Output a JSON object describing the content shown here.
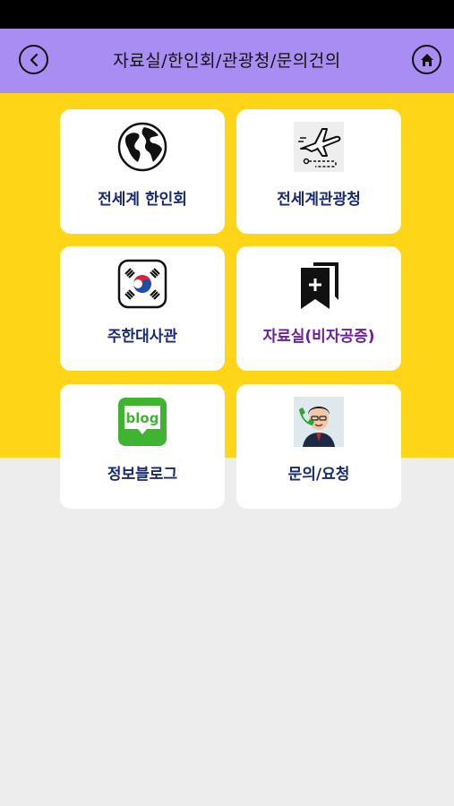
{
  "header": {
    "title": "자료실/한인회/관광청/문의건의",
    "back_icon": "chevron-left-icon",
    "home_icon": "home-icon"
  },
  "menu": [
    {
      "label": "전세계 한인회",
      "icon": "globe-icon"
    },
    {
      "label": "전세계관광청",
      "icon": "airplane-icon"
    },
    {
      "label": "주한대사관",
      "icon": "korean-flag-icon"
    },
    {
      "label": "자료실(비자공증)",
      "icon": "bookmark-plus-icon"
    },
    {
      "label": "정보블로그",
      "icon": "blog-icon",
      "icon_text": "blog"
    },
    {
      "label": "문의/요청",
      "icon": "support-agent-icon"
    }
  ],
  "colors": {
    "header": "#a98df2",
    "band": "#ffd518",
    "label": "#172a73",
    "label_highlight": "#6a1fa0",
    "blog_green": "#3fb431"
  }
}
